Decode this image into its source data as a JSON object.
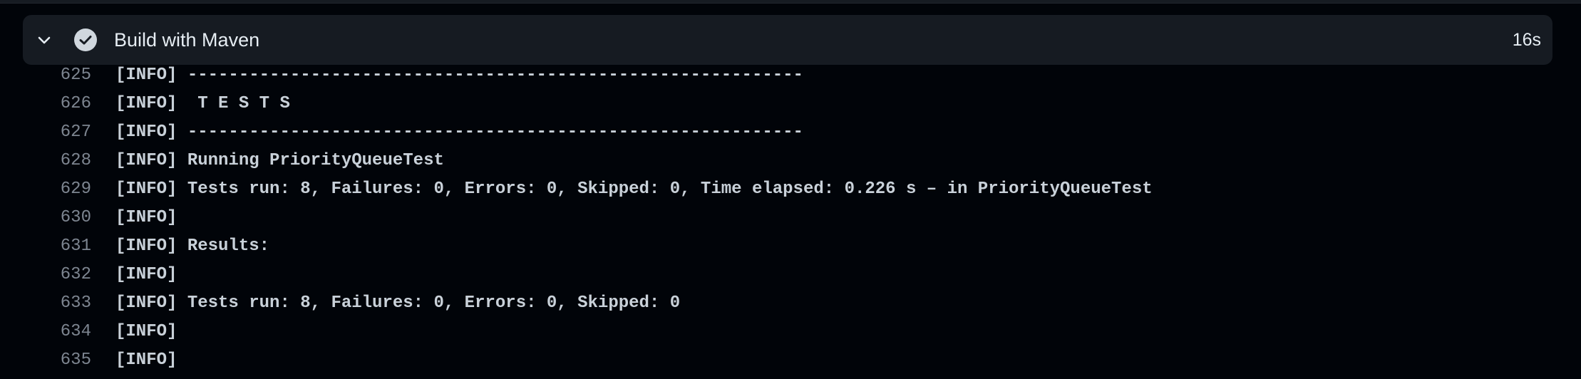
{
  "step": {
    "title": "Build with Maven",
    "duration": "16s",
    "status": "success",
    "status_color": "#e6edf3",
    "expand_icon": "chevron-down-icon",
    "status_icon": "check-circle-icon"
  },
  "log": [
    {
      "num": "625",
      "text": "[INFO] ------------------------------------------------------------"
    },
    {
      "num": "626",
      "text": "[INFO]  T E S T S"
    },
    {
      "num": "627",
      "text": "[INFO] ------------------------------------------------------------"
    },
    {
      "num": "628",
      "text": "[INFO] Running PriorityQueueTest"
    },
    {
      "num": "629",
      "text": "[INFO] Tests run: 8, Failures: 0, Errors: 0, Skipped: 0, Time elapsed: 0.226 s – in PriorityQueueTest"
    },
    {
      "num": "630",
      "text": "[INFO]"
    },
    {
      "num": "631",
      "text": "[INFO] Results:"
    },
    {
      "num": "632",
      "text": "[INFO]"
    },
    {
      "num": "633",
      "text": "[INFO] Tests run: 8, Failures: 0, Errors: 0, Skipped: 0"
    },
    {
      "num": "634",
      "text": "[INFO]"
    },
    {
      "num": "635",
      "text": "[INFO]"
    }
  ]
}
